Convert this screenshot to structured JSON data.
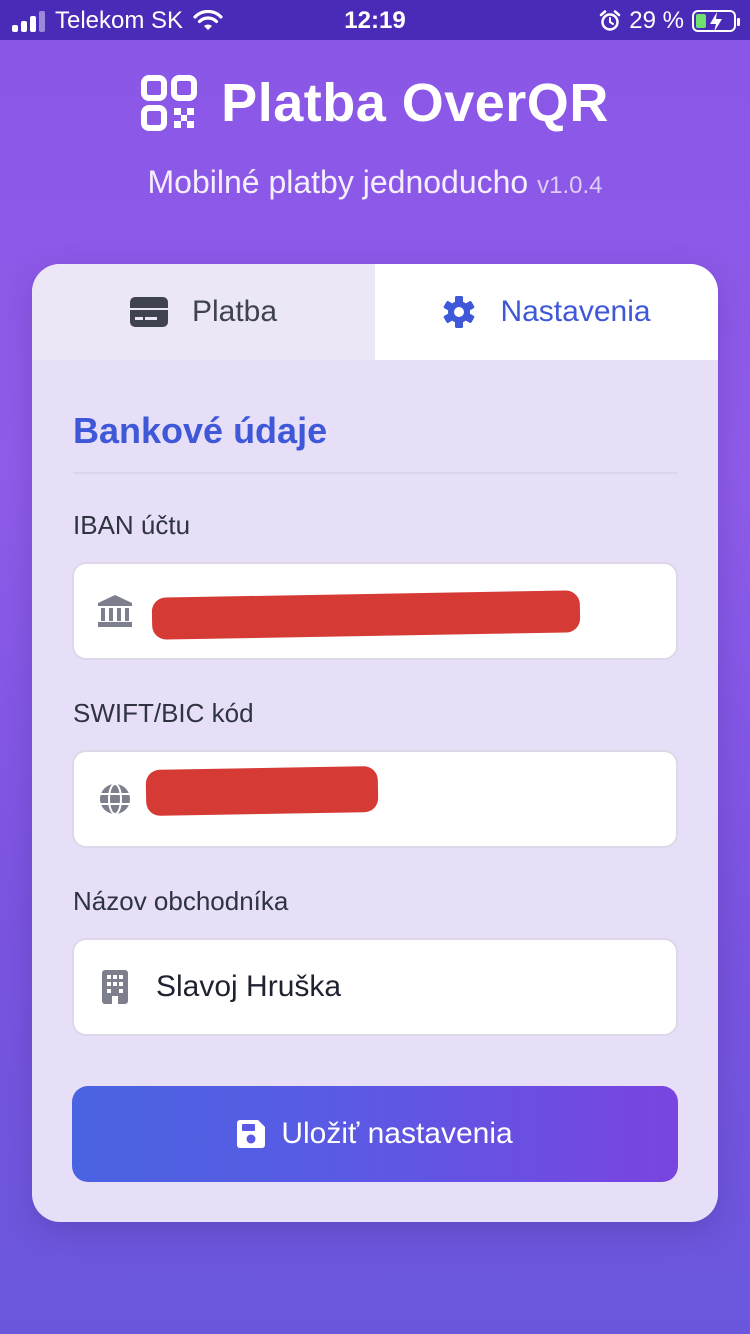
{
  "status_bar": {
    "carrier": "Telekom SK",
    "time": "12:19",
    "battery": "29 %",
    "battery_level": 0.29
  },
  "header": {
    "title": "Platba OverQR",
    "subtitle": "Mobilné platby jednoducho",
    "version": "v1.0.4"
  },
  "tabs": [
    {
      "label": "Platba",
      "icon": "credit-card-icon",
      "active": false
    },
    {
      "label": "Nastavenia",
      "icon": "gear-icon",
      "active": true
    }
  ],
  "settings": {
    "section_title": "Bankové údaje",
    "fields": [
      {
        "label": "IBAN účtu",
        "icon": "bank-icon",
        "value": "",
        "redacted": true
      },
      {
        "label": "SWIFT/BIC kód",
        "icon": "globe-icon",
        "value": "",
        "redacted": true
      },
      {
        "label": "Názov obchodníka",
        "icon": "building-icon",
        "value": "Slavoj Hruška",
        "redacted": false
      }
    ],
    "save_label": "Uložiť nastavenia"
  },
  "colors": {
    "accent": "#3e58d8",
    "background": "#8a56e6",
    "redaction": "#d32f2a"
  }
}
